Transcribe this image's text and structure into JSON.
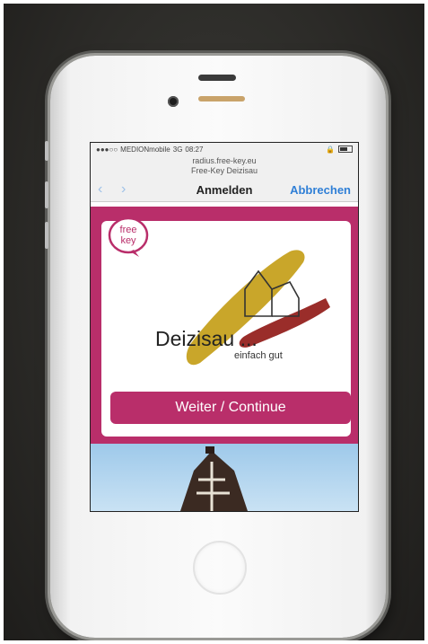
{
  "status": {
    "carrier": "MEDIONmobile",
    "network": "3G",
    "time": "08:27"
  },
  "browser": {
    "url": "radius.free-key.eu",
    "page_title": "Free-Key Deizisau",
    "back_icon": "chevron-left-icon",
    "forward_icon": "chevron-right-icon",
    "title": "Anmelden",
    "cancel_label": "Abbrechen"
  },
  "portal": {
    "logo_text_line1": "free",
    "logo_text_line2": "key",
    "town_name": "Deizisau ...",
    "slogan": "einfach gut",
    "continue_label": "Weiter / Continue"
  },
  "colors": {
    "brand": "#b92e6a",
    "link": "#2f7fd6",
    "art_yellow": "#c9a62a",
    "art_red": "#9a2d2a"
  }
}
